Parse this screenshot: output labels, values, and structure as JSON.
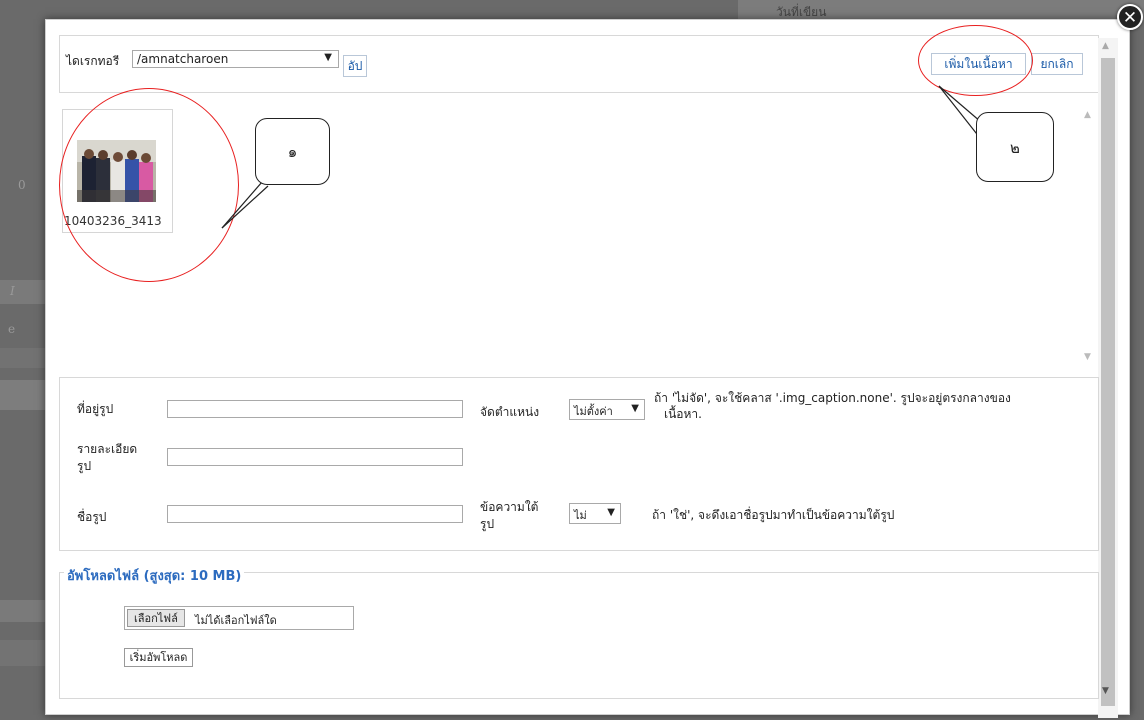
{
  "background": {
    "header_text": "วันที่เขียน",
    "left_number": "0",
    "left_italic": "I",
    "left_letter": "e"
  },
  "dialog": {
    "close_icon": "close-icon",
    "toolbar": {
      "directory_label": "ไดเรกทอรี",
      "directory_value": "/amnatcharoen",
      "up_label": "อัป",
      "insert_label": "เพิ่มในเนื้อหา",
      "cancel_label": "ยกเลิก"
    },
    "gallery": {
      "items": [
        {
          "caption": "10403236_3413"
        }
      ]
    },
    "annotations": {
      "marker_1": "๑",
      "marker_2": "๒"
    },
    "form": {
      "url_label": "ที่อยู่รูป",
      "url_value": "",
      "desc_label_1": "รายละเอียด",
      "desc_label_2": "รูป",
      "desc_value": "",
      "name_label": "ชื่อรูป",
      "name_value": "",
      "align_label": "จัดตำแหน่ง",
      "align_value": "ไม่ตั้งค่า",
      "align_hint_1": "ถ้า 'ไม่จัด', จะใช้คลาส '.img_caption.none'. รูปจะอยู่ตรงกลางของ",
      "align_hint_2": "เนื้อหา.",
      "caption_label_1": "ข้อความใต้",
      "caption_label_2": "รูป",
      "caption_value": "ไม่",
      "caption_hint": "ถ้า 'ใช่', จะดึงเอาชื่อรูปมาทำเป็นข้อความใต้รูป"
    },
    "upload": {
      "legend": "อัพโหลดไฟล์ (สูงสุด: 10 MB)",
      "choose_label": "เลือกไฟล์",
      "no_file_label": "ไม่ได้เลือกไฟล์ใด",
      "start_label": "เริ่มอัพโหลด"
    }
  }
}
